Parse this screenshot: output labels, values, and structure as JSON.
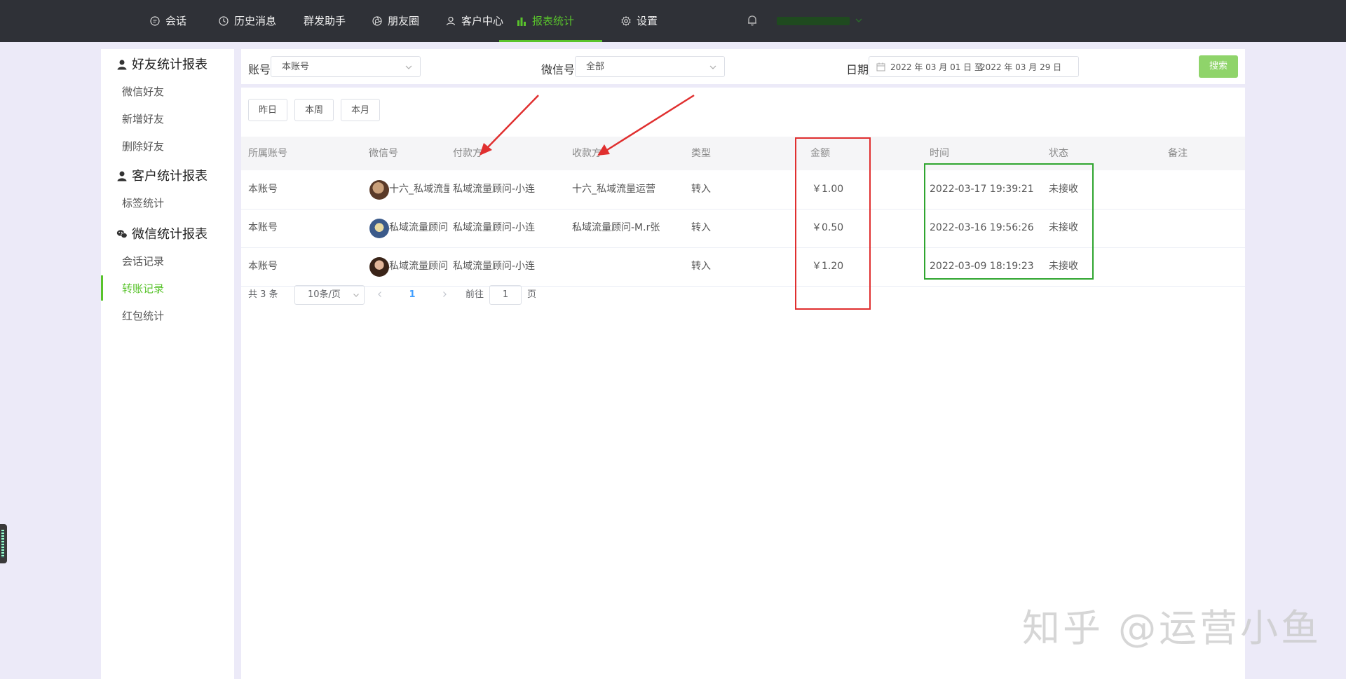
{
  "nav": {
    "items": [
      {
        "label": "会话",
        "icon": "chat-icon"
      },
      {
        "label": "历史消息",
        "icon": "clock-icon"
      },
      {
        "label": "群发助手",
        "icon": ""
      },
      {
        "label": "朋友圈",
        "icon": "aperture-icon"
      },
      {
        "label": "客户中心",
        "icon": "user-icon"
      },
      {
        "label": "报表统计",
        "icon": "bar-chart-icon",
        "active": true
      },
      {
        "label": "设置",
        "icon": "gear-icon"
      }
    ],
    "accent_color": "#59c32c"
  },
  "sidebar": {
    "groups": [
      {
        "title": "好友统计报表",
        "icon": "person-icon",
        "items": [
          "微信好友",
          "新增好友",
          "删除好友"
        ]
      },
      {
        "title": "客户统计报表",
        "icon": "person-icon",
        "items": [
          "标签统计"
        ]
      },
      {
        "title": "微信统计报表",
        "icon": "wechat-icon",
        "items": [
          "会话记录",
          "转账记录",
          "红包统计"
        ]
      }
    ],
    "active_item": "转账记录"
  },
  "filters": {
    "account_label": "账号",
    "account_value": "本账号",
    "wechat_label": "微信号",
    "wechat_value": "全部",
    "date_label": "日期",
    "date_start": "2022 年 03 月 01 日",
    "date_sep": "至",
    "date_end": "2022 年 03 月 29 日",
    "search_label": "搜索"
  },
  "quick_buttons": [
    "昨日",
    "本周",
    "本月"
  ],
  "table": {
    "columns": [
      "所属账号",
      "微信号",
      "付款方",
      "收款方",
      "类型",
      "金额",
      "时间",
      "状态",
      "备注"
    ],
    "rows": [
      {
        "account": "本账号",
        "wechat": "十六_私域流量",
        "payer": "私域流量顾问-小连",
        "payee": "十六_私域流量运营",
        "type": "转入",
        "amount": "￥1.00",
        "time": "2022-03-17 19:39:21",
        "status": "未接收",
        "remark": ""
      },
      {
        "account": "本账号",
        "wechat": "私域流量顾问",
        "payer": "私域流量顾问-小连",
        "payee": "私域流量顾问-M.r张",
        "type": "转入",
        "amount": "￥0.50",
        "time": "2022-03-16 19:56:26",
        "status": "未接收",
        "remark": ""
      },
      {
        "account": "本账号",
        "wechat": "私域流量顾问",
        "payer": "私域流量顾问-小连",
        "payee": "",
        "type": "转入",
        "amount": "￥1.20",
        "time": "2022-03-09 18:19:23",
        "status": "未接收",
        "remark": ""
      }
    ]
  },
  "pagination": {
    "total": "共 3 条",
    "page_size": "10条/页",
    "current": "1",
    "goto_prefix": "前往",
    "goto_value": "1",
    "goto_suffix": "页"
  },
  "annotations": {
    "arrow_color": "#e02f2f",
    "amount_box_color": "#e02f2f",
    "time_status_box_color": "#2fa52f"
  },
  "watermark": "知乎 @运营小鱼"
}
